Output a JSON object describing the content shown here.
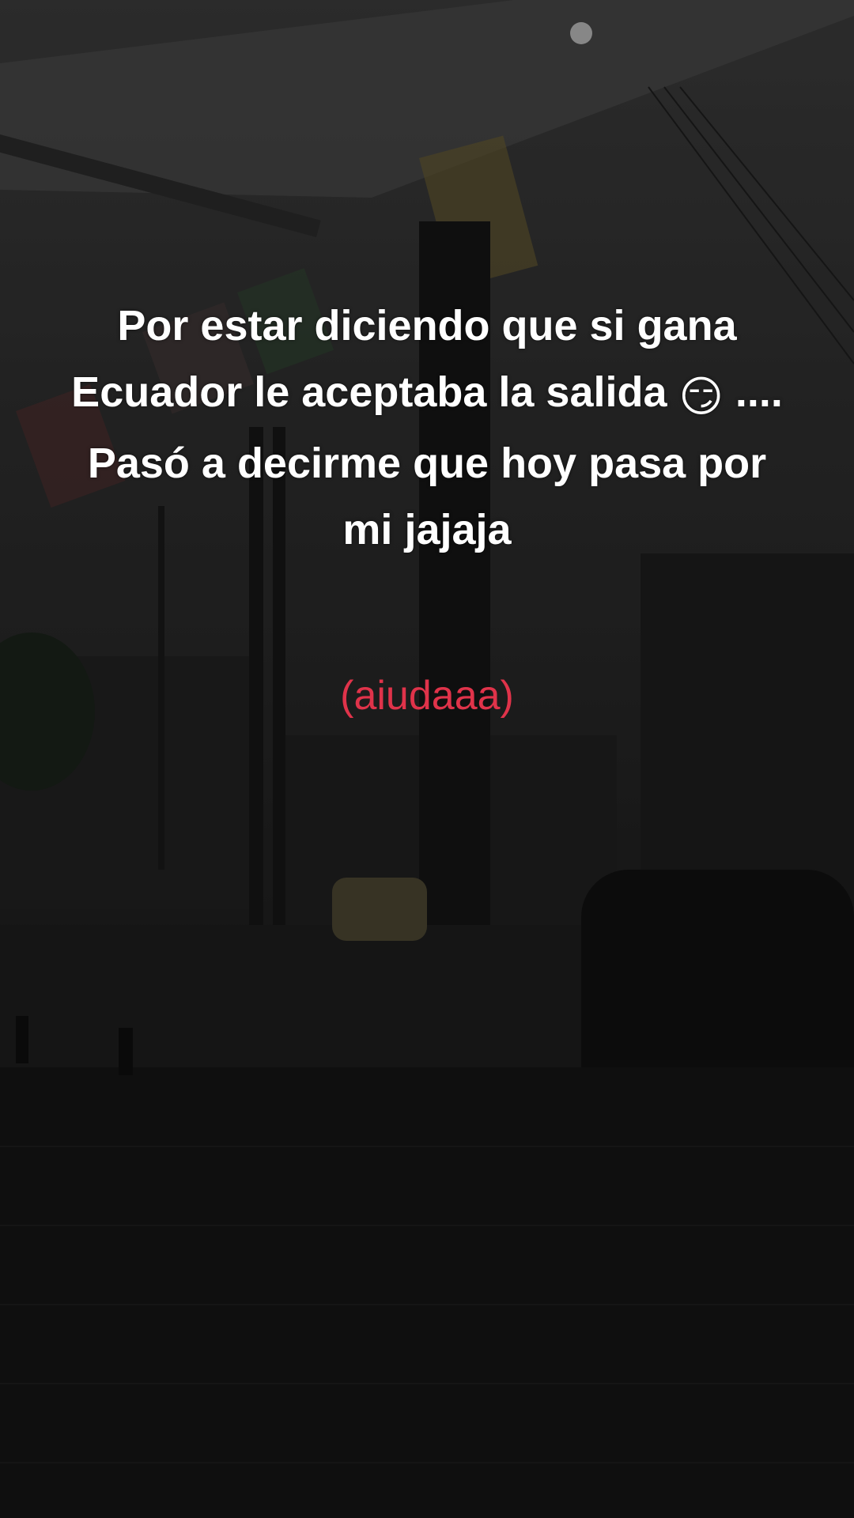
{
  "caption": {
    "line1": "Por estar diciendo que si gana",
    "line2_text": "Ecuador le aceptaba la salida ",
    "line2_emoji": "😏",
    "line2_suffix": " ....",
    "line3": "Pasó a decirme que hoy pasa por",
    "line4": "mi  jajaja"
  },
  "subcaption": "(aiudaaa)",
  "colors": {
    "caption": "#ffffff",
    "subcaption": "#e0334a"
  },
  "icons": [
    "smirking-face-emoji"
  ]
}
